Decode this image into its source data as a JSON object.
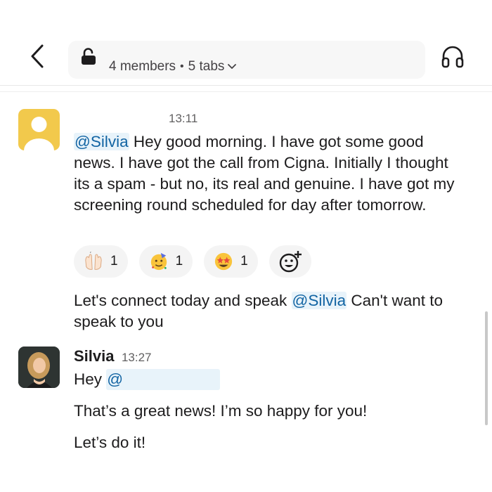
{
  "header": {
    "channel_meta": {
      "members": "4 members",
      "separator": "•",
      "tabs": "5 tabs"
    }
  },
  "messages": [
    {
      "time": "13:11",
      "mention": "@Silvia",
      "text": "Hey good morning. I have got some good news. I have got the call from Cigna. Initially I thought its a spam - but no, its real and genuine. I have got my screening round scheduled for day after tomorrow.",
      "reactions": [
        {
          "emoji": "raising-hands",
          "count": "1"
        },
        {
          "emoji": "partying-face",
          "count": "1"
        },
        {
          "emoji": "star-struck",
          "count": "1"
        }
      ],
      "followup_before": "Let's connect today and speak ",
      "followup_mention": "@Silvia",
      "followup_after": " Can't want to speak to you"
    },
    {
      "sender": "Silvia",
      "time": "13:27",
      "line1_prefix": "Hey ",
      "line1_mention": "@",
      "line2": "That’s a great news! I’m so happy for you!",
      "line3": "Let’s do it!"
    }
  ]
}
